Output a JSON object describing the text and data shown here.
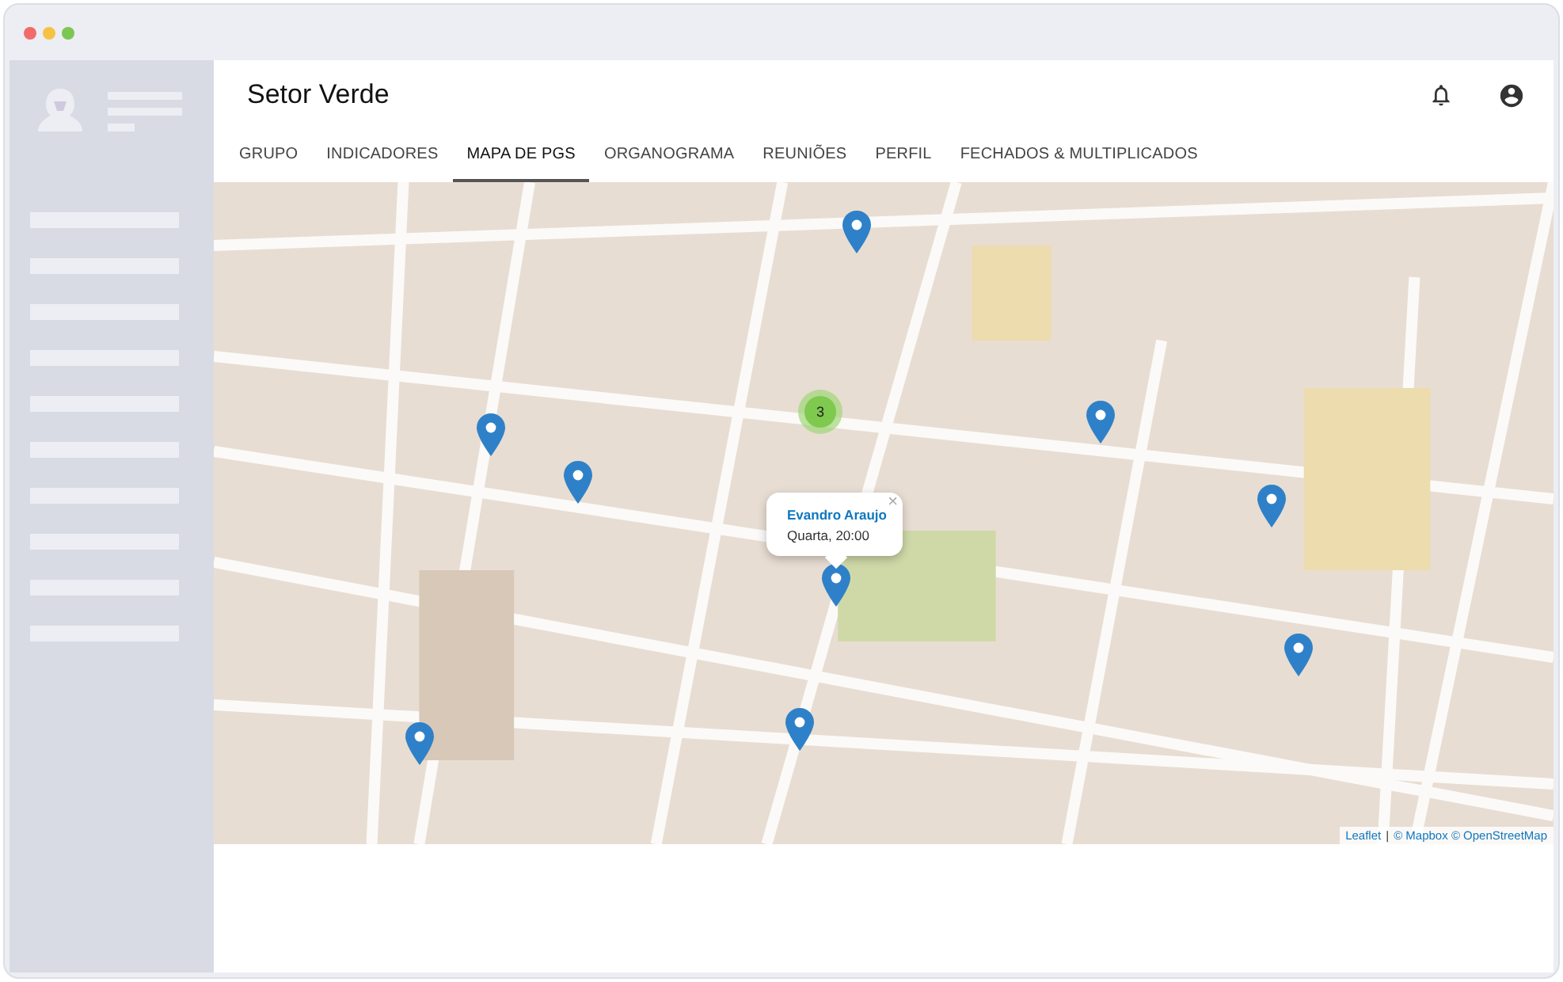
{
  "header": {
    "title": "Setor Verde"
  },
  "tabs": [
    {
      "label": "GRUPO",
      "selected": false
    },
    {
      "label": "INDICADORES",
      "selected": false
    },
    {
      "label": "MAPA DE PGS",
      "selected": true
    },
    {
      "label": "ORGANOGRAMA",
      "selected": false
    },
    {
      "label": "REUNIÕES",
      "selected": false
    },
    {
      "label": "PERFIL",
      "selected": false
    },
    {
      "label": "FECHADOS & MULTIPLICADOS",
      "selected": false
    }
  ],
  "map": {
    "cluster": {
      "count": "3"
    },
    "popup": {
      "name": "Evandro Araujo",
      "time": "Quarta, 20:00",
      "close": "×"
    },
    "attribution": {
      "leaflet": "Leaflet",
      "separator": "|",
      "text": "© Mapbox © OpenStreetMap"
    }
  }
}
